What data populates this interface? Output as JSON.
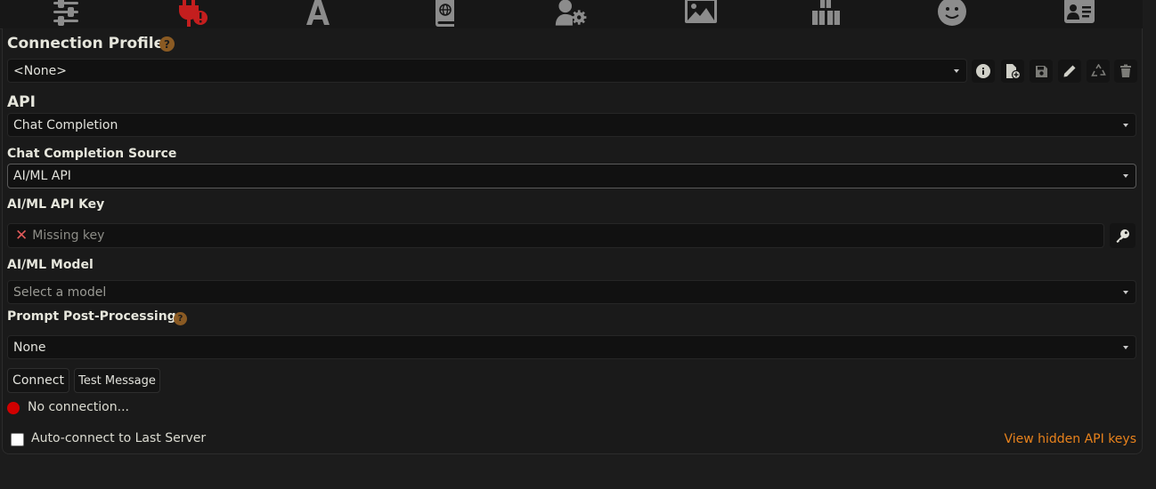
{
  "nav": {
    "icons": [
      "sliders-icon",
      "plug-icon",
      "font-icon",
      "book-atlas-icon",
      "user-gear-icon",
      "image-icon",
      "cubes-icon",
      "smile-icon",
      "address-card-icon"
    ],
    "active_color": "#c41e1e"
  },
  "connection_profile": {
    "title": "Connection Profile",
    "help": "?",
    "selected": "<None>",
    "tools": [
      "info-icon",
      "file-add-icon",
      "save-icon",
      "pencil-icon",
      "recycle-icon",
      "trash-icon"
    ]
  },
  "api": {
    "label": "API",
    "selected": "Chat Completion"
  },
  "chat_completion_source": {
    "label": "Chat Completion Source",
    "selected": "AI/ML API"
  },
  "api_key": {
    "label": "AI/ML API Key",
    "status_mark": "✕",
    "placeholder": "Missing key"
  },
  "model": {
    "label": "AI/ML Model",
    "placeholder": "Select a model"
  },
  "prompt_post_processing": {
    "label": "Prompt Post-Processing",
    "help": "?",
    "selected": "None"
  },
  "buttons": {
    "connect": "Connect",
    "test_message": "Test Message"
  },
  "status": {
    "text": "No connection...",
    "color": "#d00000"
  },
  "auto_connect": {
    "label": "Auto-connect to Last Server",
    "checked": false
  },
  "hidden_keys_link": "View hidden API keys",
  "colors": {
    "accent_help": "#8a5a23",
    "link": "#e8821c",
    "error_mark": "#e05a5a"
  }
}
